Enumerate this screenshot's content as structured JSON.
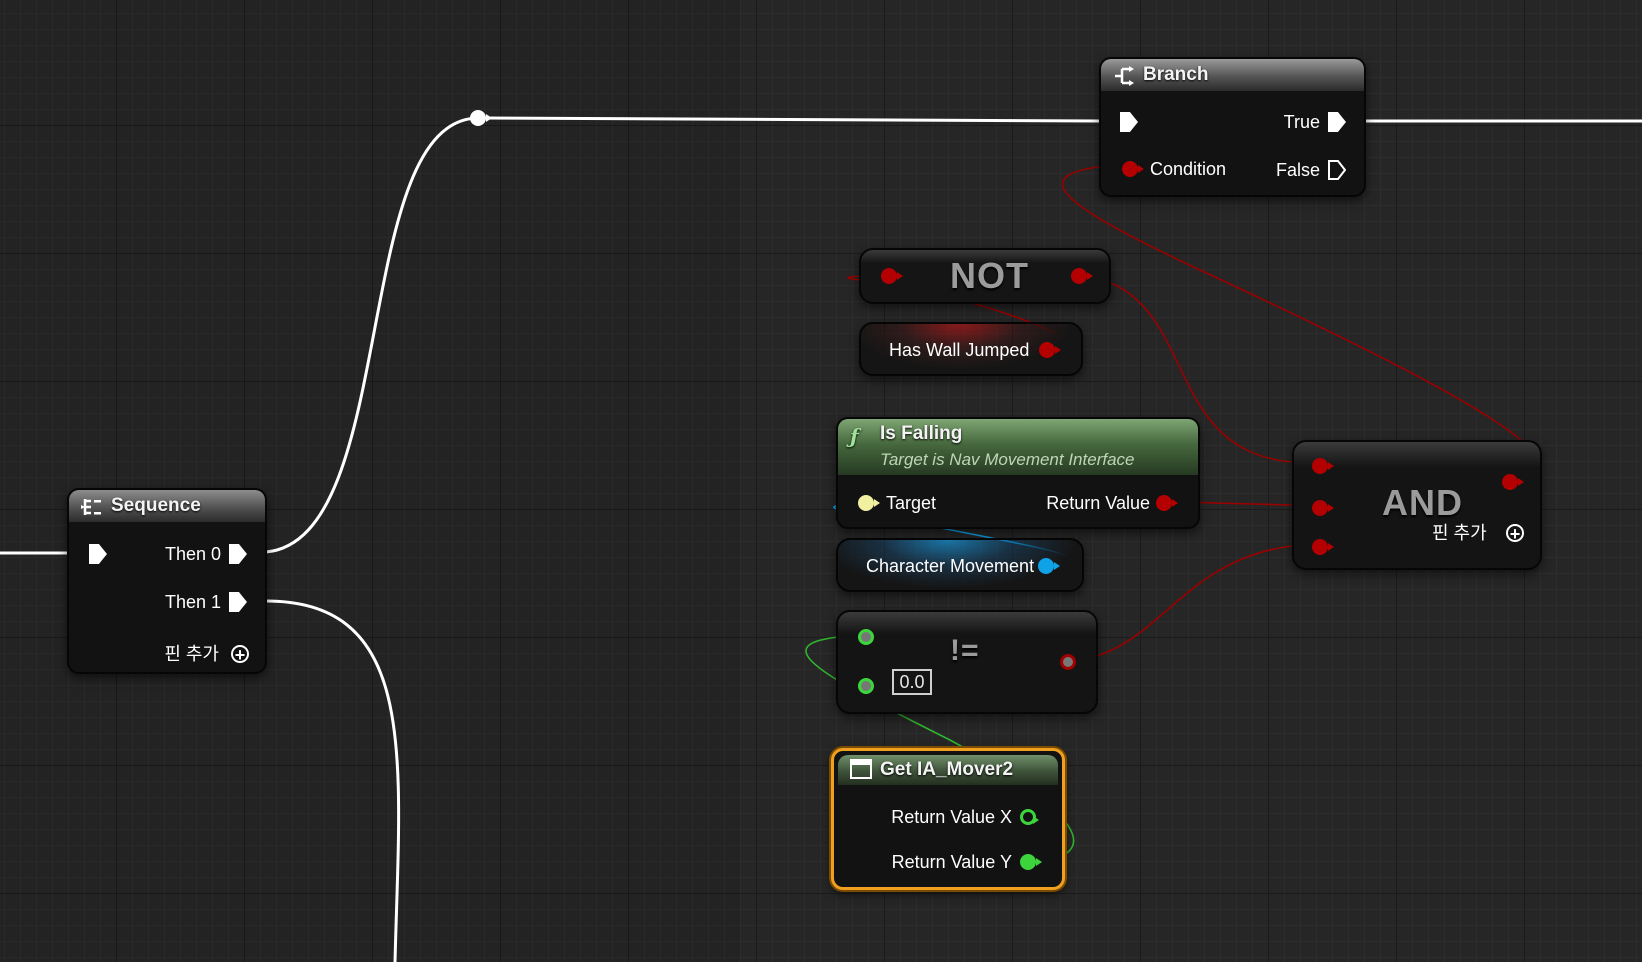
{
  "sequence": {
    "title": "Sequence",
    "then0": "Then 0",
    "then1": "Then 1",
    "add_pin": "핀 추가"
  },
  "branch": {
    "title": "Branch",
    "condition": "Condition",
    "true_label": "True",
    "false_label": "False"
  },
  "not_node": {
    "title": "NOT"
  },
  "has_wall_jumped": {
    "label": "Has Wall Jumped"
  },
  "is_falling": {
    "title": "Is Falling",
    "subtitle": "Target is Nav Movement Interface",
    "target": "Target",
    "return_value": "Return Value"
  },
  "character_movement": {
    "label": "Character Movement"
  },
  "not_equal": {
    "title": "!=",
    "default_value": "0.0"
  },
  "and_node": {
    "title": "AND",
    "add_pin": "핀 추가"
  },
  "get_ia_mover2": {
    "title": "Get IA_Mover2",
    "return_x": "Return Value X",
    "return_y": "Return Value Y"
  },
  "colors": {
    "exec": "#ffffff",
    "bool": "#b40000",
    "object": "#0fa2e6",
    "float": "#3cd63c",
    "selected": "#f0a020",
    "function_header": "#4e7a43"
  }
}
